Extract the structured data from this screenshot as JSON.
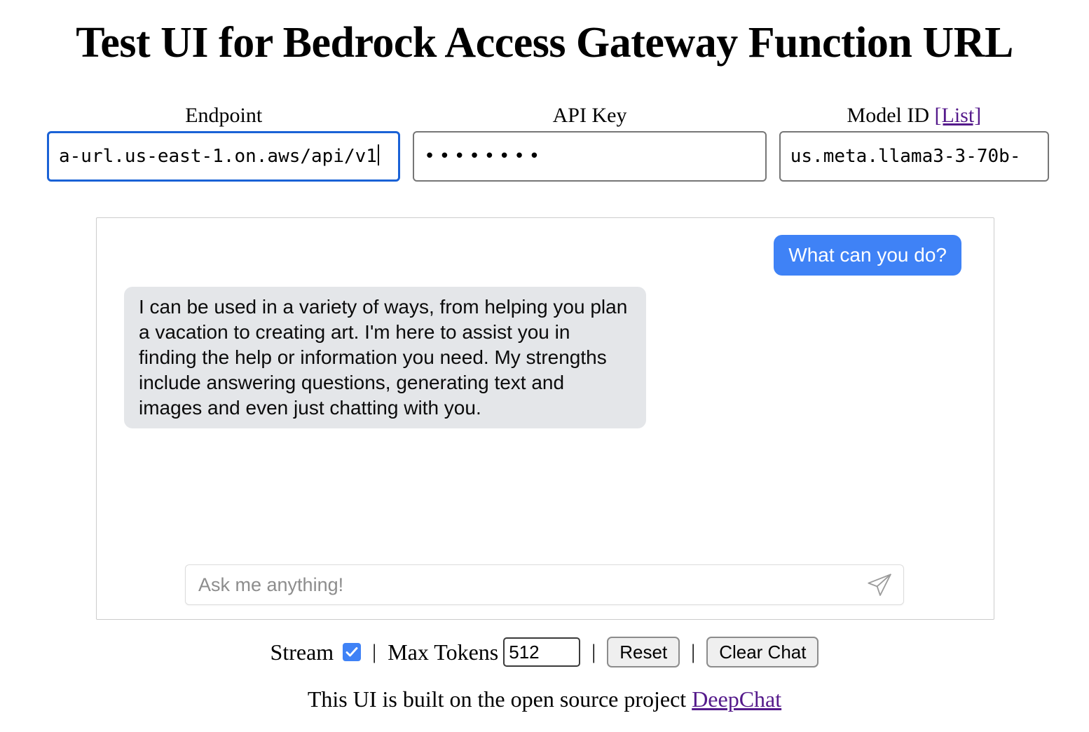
{
  "page": {
    "title": "Test UI for Bedrock Access Gateway Function URL"
  },
  "config": {
    "endpoint": {
      "label": "Endpoint",
      "value": "a-url.us-east-1.on.aws/api/v1",
      "focused": true
    },
    "api_key": {
      "label": "API Key",
      "value": "••••••••",
      "masked": true
    },
    "model_id": {
      "label": "Model ID",
      "list_link": "[List]",
      "value": "us.meta.llama3-3-70b-"
    }
  },
  "chat": {
    "messages": [
      {
        "role": "user",
        "text": "What can you do?"
      },
      {
        "role": "ai",
        "text": "I can be used in a variety of ways, from helping you plan a vacation to creating art. I'm here to assist you in finding the help or information you need. My strengths include answering questions, generating text and images and even just chatting with you."
      }
    ],
    "input": {
      "placeholder": "Ask me anything!",
      "value": "",
      "send_icon": "send-paper-plane-icon"
    }
  },
  "controls": {
    "stream_label": "Stream",
    "stream_checked": true,
    "separator": "|",
    "max_tokens_label": "Max Tokens",
    "max_tokens_value": "512",
    "reset_label": "Reset",
    "clear_chat_label": "Clear Chat"
  },
  "footer": {
    "text_before": "This UI is built on the open source project ",
    "link_label": "DeepChat"
  },
  "colors": {
    "user_bubble": "#3f82f6",
    "ai_bubble": "#e4e6e9",
    "focus_border": "#1a62d6",
    "link": "#551a8b",
    "panel_border": "#cccccc"
  }
}
